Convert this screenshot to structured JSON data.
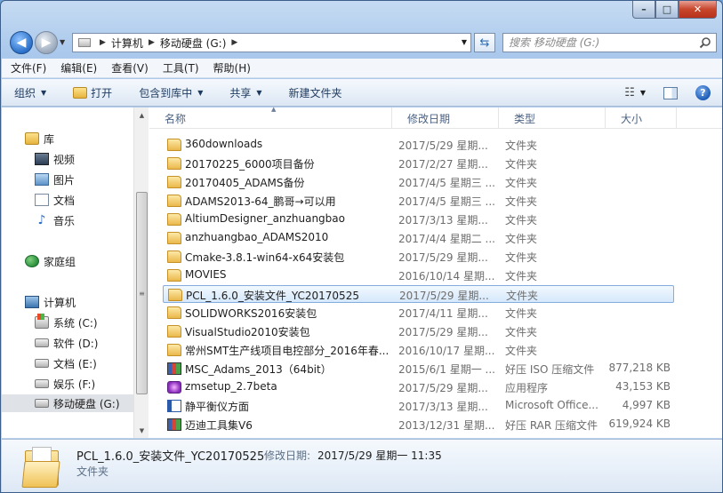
{
  "window": {
    "caption": {
      "minimize": "–",
      "maximize": "□",
      "close": "✕"
    }
  },
  "address": {
    "crumbs": [
      "计算机",
      "移动硬盘 (G:)"
    ],
    "search_placeholder": "搜索 移动硬盘 (G:)"
  },
  "menu": [
    "文件(F)",
    "编辑(E)",
    "查看(V)",
    "工具(T)",
    "帮助(H)"
  ],
  "commands": {
    "organize": "组织",
    "open": "打开",
    "include_in_library": "包含到库中",
    "share": "共享",
    "new_folder": "新建文件夹"
  },
  "nav_tree": {
    "libraries": "库",
    "videos": "视频",
    "pictures": "图片",
    "documents": "文档",
    "music": "音乐",
    "homegroup": "家庭组",
    "computer": "计算机",
    "drives": [
      {
        "label": "系统 (C:)",
        "icon": "system-drive-icon"
      },
      {
        "label": "软件 (D:)",
        "icon": "drive-icon"
      },
      {
        "label": "文档 (E:)",
        "icon": "drive-icon"
      },
      {
        "label": "娱乐 (F:)",
        "icon": "drive-icon"
      },
      {
        "label": "移动硬盘 (G:)",
        "icon": "drive-icon",
        "selected": true
      }
    ]
  },
  "columns": {
    "name": "名称",
    "date": "修改日期",
    "type": "类型",
    "size": "大小"
  },
  "files": [
    {
      "name": "360downloads",
      "date": "2017/5/29 星期...",
      "type": "文件夹",
      "size": "",
      "icon": "folder"
    },
    {
      "name": "20170225_6000项目备份",
      "date": "2017/2/27 星期...",
      "type": "文件夹",
      "size": "",
      "icon": "folder"
    },
    {
      "name": "20170405_ADAMS备份",
      "date": "2017/4/5 星期三 ...",
      "type": "文件夹",
      "size": "",
      "icon": "folder"
    },
    {
      "name": "ADAMS2013-64_鹏哥→可以用",
      "date": "2017/4/5 星期三 ...",
      "type": "文件夹",
      "size": "",
      "icon": "folder"
    },
    {
      "name": "AltiumDesigner_anzhuangbao",
      "date": "2017/3/13 星期...",
      "type": "文件夹",
      "size": "",
      "icon": "folder"
    },
    {
      "name": "anzhuangbao_ADAMS2010",
      "date": "2017/4/4 星期二 ...",
      "type": "文件夹",
      "size": "",
      "icon": "folder"
    },
    {
      "name": "Cmake-3.8.1-win64-x64安装包",
      "date": "2017/5/29 星期...",
      "type": "文件夹",
      "size": "",
      "icon": "folder"
    },
    {
      "name": "MOVIES",
      "date": "2016/10/14 星期...",
      "type": "文件夹",
      "size": "",
      "icon": "folder"
    },
    {
      "name": "PCL_1.6.0_安装文件_YC20170525",
      "date": "2017/5/29 星期...",
      "type": "文件夹",
      "size": "",
      "icon": "folder",
      "selected": true
    },
    {
      "name": "SOLIDWORKS2016安装包",
      "date": "2017/4/11 星期...",
      "type": "文件夹",
      "size": "",
      "icon": "folder"
    },
    {
      "name": "VisualStudio2010安装包",
      "date": "2017/5/29 星期...",
      "type": "文件夹",
      "size": "",
      "icon": "folder"
    },
    {
      "name": "常州SMT生产线项目电控部分_2016年春...",
      "date": "2016/10/17 星期...",
      "type": "文件夹",
      "size": "",
      "icon": "folder"
    },
    {
      "name": "MSC_Adams_2013（64bit）",
      "date": "2015/6/1 星期一 ...",
      "type": "好压 ISO 压缩文件",
      "size": "877,218 KB",
      "icon": "iso"
    },
    {
      "name": "zmsetup_2.7beta",
      "date": "2017/5/29 星期...",
      "type": "应用程序",
      "size": "43,153 KB",
      "icon": "exe"
    },
    {
      "name": "静平衡仪方面",
      "date": "2017/3/13 星期...",
      "type": "Microsoft Office...",
      "size": "4,997 KB",
      "icon": "doc"
    },
    {
      "name": "迈迪工具集V6",
      "date": "2013/12/31 星期...",
      "type": "好压 RAR 压缩文件",
      "size": "619,924 KB",
      "icon": "rar"
    }
  ],
  "details": {
    "name": "PCL_1.6.0_安装文件_YC20170525",
    "modified_label": "修改日期:",
    "modified_value": "2017/5/29 星期一 11:35",
    "type": "文件夹"
  }
}
